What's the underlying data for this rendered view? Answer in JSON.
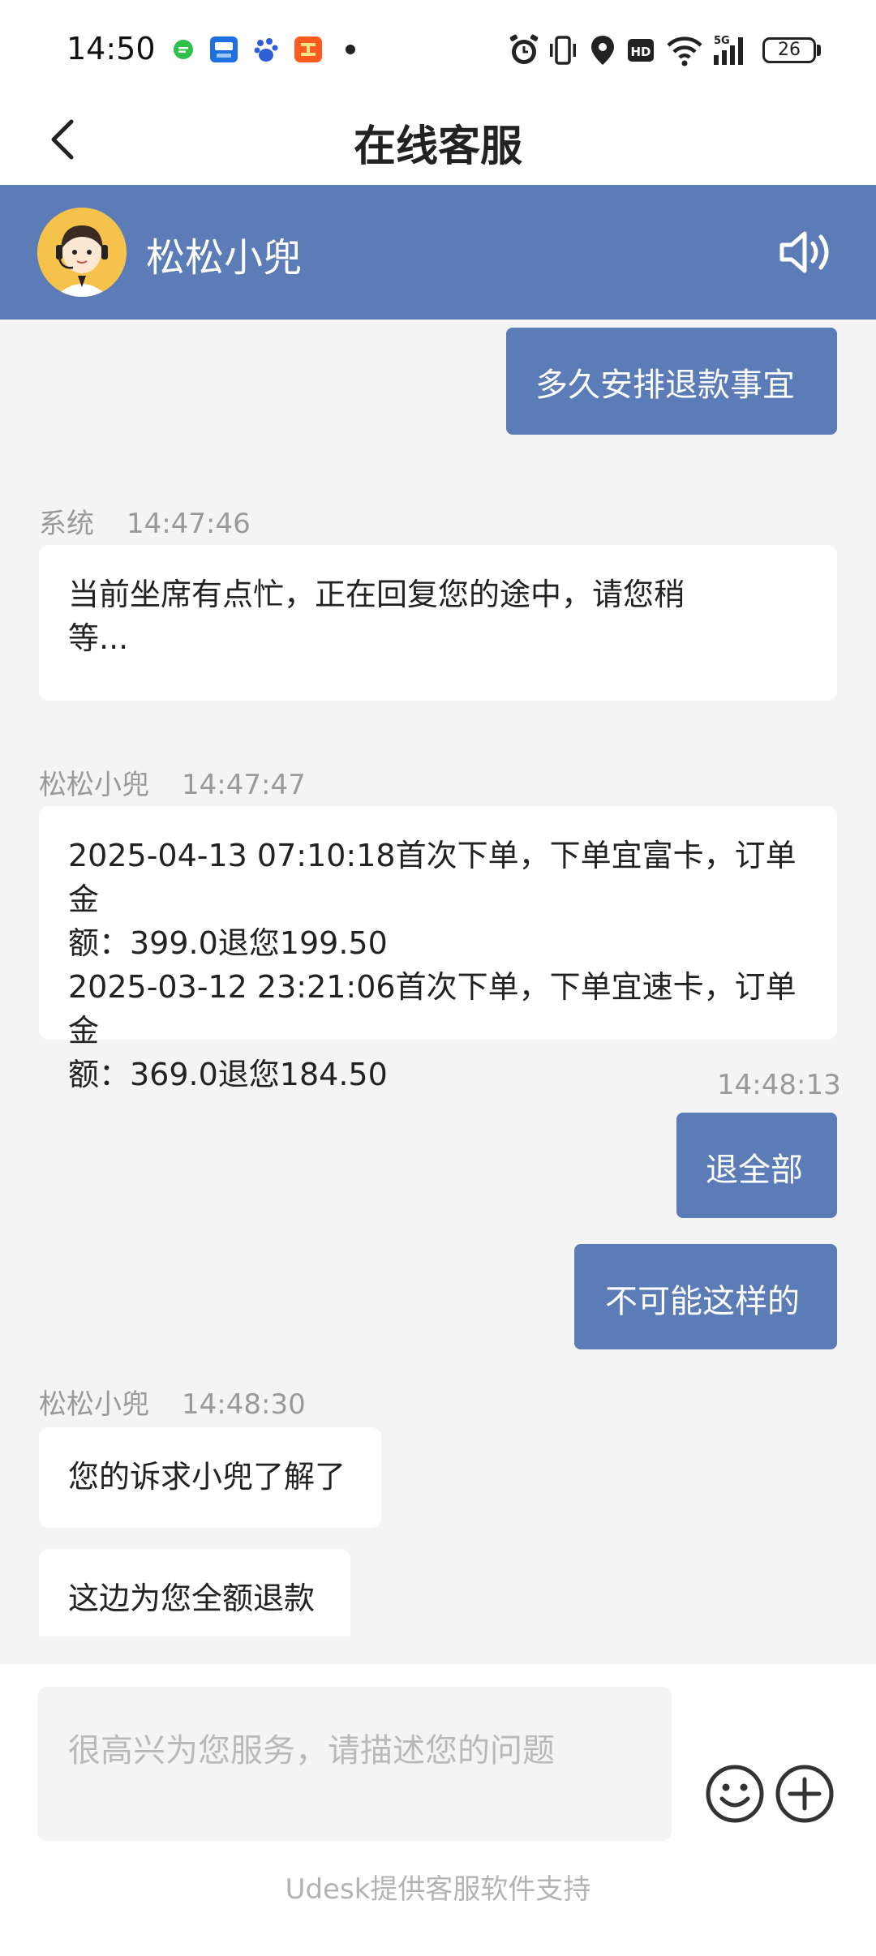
{
  "status_bar": {
    "time": "14:50",
    "battery": "26",
    "icons": [
      "message-bubble-icon",
      "app-badge-icon",
      "baidu-paw-icon",
      "taobao-icon",
      "dot-icon",
      "alarm-icon",
      "vibrate-icon",
      "location-icon",
      "hd-icon",
      "wifi-icon",
      "5g-signal-icon",
      "battery-icon"
    ]
  },
  "titlebar": {
    "title": "在线客服",
    "back_icon": "chevron-left-icon"
  },
  "agent": {
    "name": "松松小兜",
    "avatar_icon": "agent-avatar-icon",
    "sound_icon": "speaker-icon"
  },
  "messages": [
    {
      "side": "right",
      "text": "多久安排退款事宜"
    },
    {
      "side": "left",
      "sender": "系统",
      "time": "14:47:46",
      "lines": [
        "当前坐席有点忙，正在回复您的途中，请您稍",
        "等..."
      ]
    },
    {
      "side": "left",
      "sender": "松松小兜",
      "time": "14:47:47",
      "lines": [
        "2025-04-13 07:10:18首次下单，下单宜富卡，订单金",
        "额：399.0退您199.50",
        "2025-03-12 23:21:06首次下单，下单宜速卡，订单金",
        "额：369.0退您184.50"
      ]
    },
    {
      "side": "right",
      "time": "14:48:13",
      "text": "退全部"
    },
    {
      "side": "right",
      "text": "不可能这样的"
    },
    {
      "side": "left",
      "sender": "松松小兜",
      "time": "14:48:30",
      "text": "您的诉求小兜了解了"
    },
    {
      "side": "left",
      "text": "这边为您全额退款"
    }
  ],
  "input": {
    "placeholder": "很高兴为您服务，请描述您的问题",
    "emoji_icon": "smiley-icon",
    "plus_icon": "plus-circle-icon",
    "powered_by": "Udesk提供客服软件支持"
  },
  "colors": {
    "brand": "#5c7cb8",
    "background": "#f4f4f4",
    "bubble_left": "#ffffff",
    "meta_text": "#9a9a9a"
  }
}
